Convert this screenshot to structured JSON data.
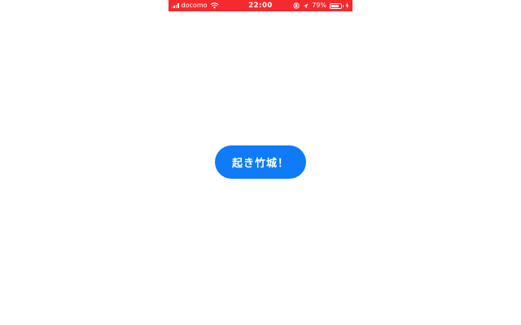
{
  "status_bar": {
    "carrier": "docomo",
    "time": "22:00",
    "battery_percent": "79%",
    "battery_level": 0.79,
    "background_color": "#f42a2f",
    "icons": [
      "signal-icon",
      "wifi-icon",
      "orientation-lock-icon",
      "location-icon",
      "battery-icon",
      "charging-icon"
    ]
  },
  "main": {
    "button_label": "起き竹城！",
    "button_color": "#0f7bf7"
  }
}
